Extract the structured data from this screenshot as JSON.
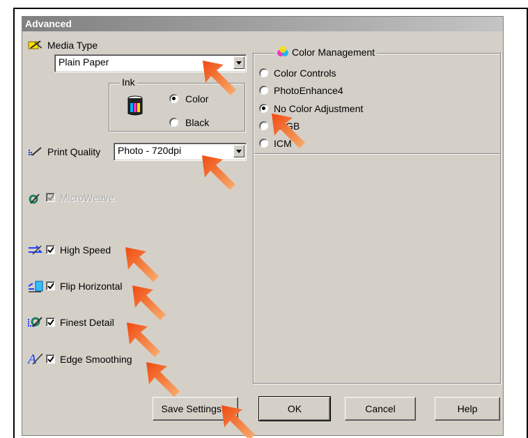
{
  "window": {
    "title": "Advanced"
  },
  "media": {
    "label": "Media Type",
    "value": "Plain Paper"
  },
  "ink": {
    "group_label": "Ink",
    "options": [
      "Color",
      "Black"
    ],
    "selected": "Color"
  },
  "quality": {
    "label": "Print Quality",
    "value": "Photo - 720dpi"
  },
  "options": {
    "microweave": {
      "label": "MicroWeave",
      "checked": true,
      "enabled": false
    },
    "high_speed": {
      "label": "High Speed",
      "checked": true
    },
    "flip_horizontal": {
      "label": "Flip Horizontal",
      "checked": true
    },
    "finest_detail": {
      "label": "Finest Detail",
      "checked": true
    },
    "edge_smoothing": {
      "label": "Edge Smoothing",
      "checked": true
    }
  },
  "color_management": {
    "group_label": "Color Management",
    "options": [
      "Color Controls",
      "PhotoEnhance4",
      "No Color Adjustment",
      "sRGB",
      "ICM"
    ],
    "selected": "No Color Adjustment"
  },
  "buttons": {
    "save": "Save Settings...",
    "ok": "OK",
    "cancel": "Cancel",
    "help": "Help"
  },
  "colors": {
    "dialog_bg": "#d4d0c8",
    "annotation_arrow": "#f0641e"
  }
}
